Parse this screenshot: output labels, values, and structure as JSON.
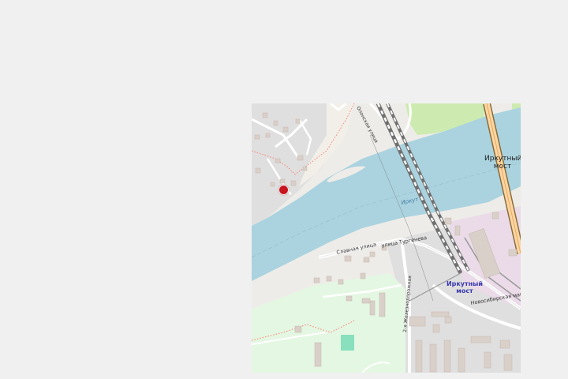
{
  "map": {
    "labels": {
      "bridge": "Иркутный мост",
      "station": "Иркутный мост",
      "river": "Иркут",
      "street_slavnaya": "Славная улица",
      "street_turgeneva": "улица Тургенева",
      "street_olonskaya": "Олонская улица",
      "street_zheleznodorozhnaya": "2-я Железнодорожная",
      "street_novosibirskaya": "Новосибирская магистраль"
    },
    "marker": {
      "color": "#c8141e"
    },
    "colors": {
      "water": "#aad3df",
      "grass": "#cdebb0",
      "park": "#e4f7e2",
      "residential": "#e0dfdf",
      "industrial": "#ebdbe8",
      "building": "#d9d0c9",
      "pitch": "#88e0be"
    }
  }
}
